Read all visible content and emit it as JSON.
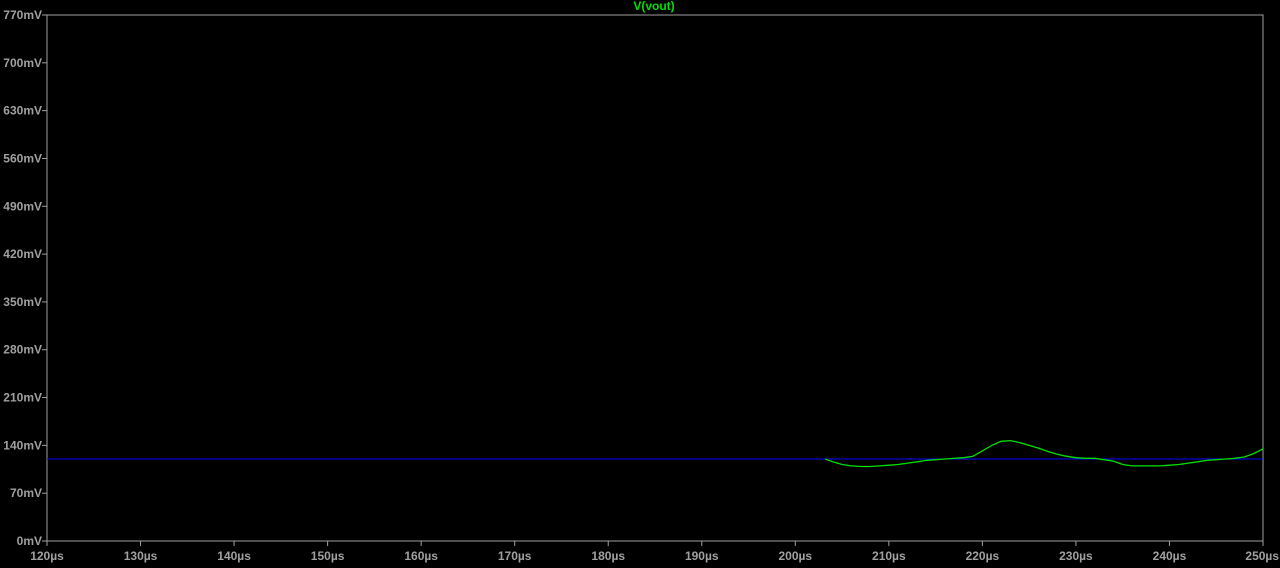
{
  "chart_data": {
    "type": "line",
    "title": "V(vout)",
    "xlabel": "",
    "ylabel": "",
    "grid": false,
    "xlim": [
      120,
      250
    ],
    "ylim": [
      0,
      770
    ],
    "x_tick_values": [
      120,
      130,
      140,
      150,
      160,
      170,
      180,
      190,
      200,
      210,
      220,
      230,
      240,
      250
    ],
    "x_tick_labels": [
      "120µs",
      "130µs",
      "140µs",
      "150µs",
      "160µs",
      "170µs",
      "180µs",
      "190µs",
      "200µs",
      "210µs",
      "220µs",
      "230µs",
      "240µs",
      "250µs"
    ],
    "y_tick_values": [
      0,
      70,
      140,
      210,
      280,
      350,
      420,
      490,
      560,
      630,
      700,
      770
    ],
    "y_tick_labels": [
      "0mV",
      "70mV",
      "140mV",
      "210mV",
      "280mV",
      "350mV",
      "420mV",
      "490mV",
      "560mV",
      "630mV",
      "700mV",
      "770mV"
    ],
    "series": [
      {
        "name": "V(vout)",
        "color": "#00e000",
        "x": [
          203.2,
          204,
          205,
          206,
          207,
          208,
          209,
          210,
          211,
          212,
          213,
          214,
          215,
          216,
          217,
          218,
          219,
          220,
          221,
          222,
          223,
          224,
          225,
          226,
          227,
          228,
          229,
          230,
          231,
          232,
          233,
          234,
          235,
          236,
          237,
          238,
          239,
          240,
          241,
          242,
          243,
          244,
          245,
          246,
          247,
          248,
          249,
          250
        ],
        "y": [
          120,
          116,
          112,
          110,
          109,
          109,
          110,
          111,
          112,
          114,
          116,
          118,
          119,
          120,
          121,
          122,
          124,
          132,
          140,
          146,
          147,
          144,
          140,
          136,
          131,
          127,
          124,
          122,
          121,
          121,
          119,
          117,
          112,
          110,
          110,
          110,
          110,
          111,
          112,
          114,
          116,
          118,
          119,
          120,
          121,
          123,
          128,
          135
        ]
      }
    ],
    "reference_line": {
      "y": 120,
      "color": "#0000ff",
      "x_start": 120,
      "x_end": 250
    },
    "colors": {
      "background": "#000000",
      "axis": "#a0a0a0",
      "tick_text": "#a0a0a0",
      "title_text": "#00e000"
    }
  }
}
